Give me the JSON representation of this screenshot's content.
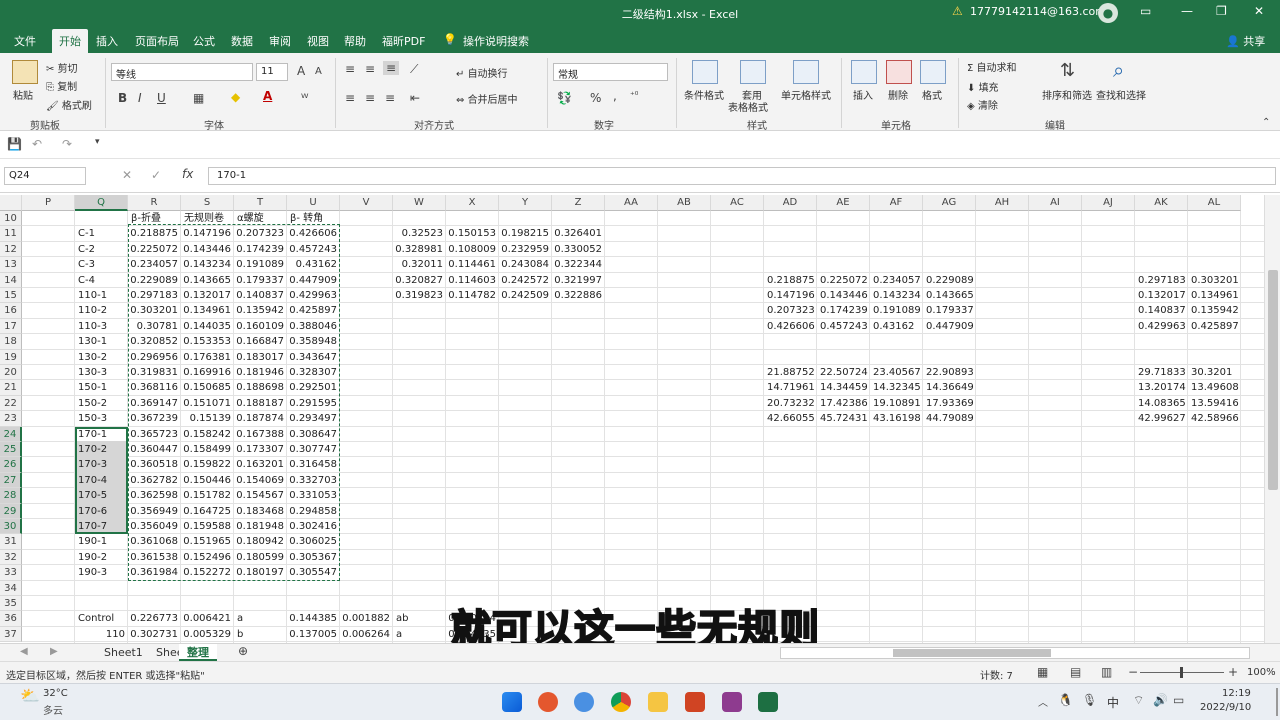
{
  "window": {
    "title": "二级结构1.xlsx  -  Excel",
    "account": "17779142114@163.com"
  },
  "menu": [
    "文件",
    "开始",
    "插入",
    "页面布局",
    "公式",
    "数据",
    "审阅",
    "视图",
    "帮助",
    "福昕PDF",
    "操作说明搜索",
    "共享"
  ],
  "ribbon": {
    "clipboard": {
      "paste": "粘贴",
      "cut": "剪切",
      "copy": "复制",
      "format_painter": "格式刷",
      "group": "剪贴板"
    },
    "font": {
      "name": "等线",
      "size": "11",
      "group": "字体",
      "bold": "B",
      "italic": "I",
      "underline": "U",
      "color_a": "A"
    },
    "align": {
      "wrap": "自动换行",
      "merge": "合并后居中",
      "group": "对齐方式"
    },
    "number": {
      "format": "常规",
      "group": "数字",
      "percent": "%",
      "comma": ","
    },
    "styles": {
      "cond": "条件格式",
      "table1": "套用",
      "table2": "表格格式",
      "cell": "单元格样式",
      "group": "样式"
    },
    "cells": {
      "insert": "插入",
      "delete": "删除",
      "format": "格式",
      "group": "单元格"
    },
    "edit": {
      "autosum": "自动求和",
      "fill": "填充",
      "clear": "清除",
      "sort": "排序和筛选",
      "find": "查找和选择",
      "group": "编辑"
    }
  },
  "formula_bar": {
    "name_box": "Q24",
    "formula": "170-1",
    "fx": "fx"
  },
  "columns": [
    "P",
    "Q",
    "R",
    "S",
    "T",
    "U",
    "V",
    "W",
    "X",
    "Y",
    "Z",
    "AA",
    "AB",
    "AC",
    "AD",
    "AE",
    "AF",
    "AG",
    "AH",
    "AI",
    "AJ",
    "AK",
    "AL"
  ],
  "rows": [
    "10",
    "11",
    "12",
    "13",
    "14",
    "15",
    "16",
    "17",
    "18",
    "19",
    "20",
    "21",
    "22",
    "23",
    "24",
    "25",
    "26",
    "27",
    "28",
    "29",
    "30",
    "31",
    "32",
    "33",
    "34",
    "35",
    "36",
    "37"
  ],
  "headers_row10": {
    "R": "β-折叠",
    "S": "无规则卷",
    "T": "α螺旋",
    "U": "β- 转角"
  },
  "left_table": [
    [
      "C-1",
      "0.218875",
      "0.147196",
      "0.207323",
      "0.426606"
    ],
    [
      "C-2",
      "0.225072",
      "0.143446",
      "0.174239",
      "0.457243"
    ],
    [
      "C-3",
      "0.234057",
      "0.143234",
      "0.191089",
      "0.43162"
    ],
    [
      "C-4",
      "0.229089",
      "0.143665",
      "0.179337",
      "0.447909"
    ],
    [
      "110-1",
      "0.297183",
      "0.132017",
      "0.140837",
      "0.429963"
    ],
    [
      "110-2",
      "0.303201",
      "0.134961",
      "0.135942",
      "0.425897"
    ],
    [
      "110-3",
      "0.30781",
      "0.144035",
      "0.160109",
      "0.388046"
    ],
    [
      "130-1",
      "0.320852",
      "0.153353",
      "0.166847",
      "0.358948"
    ],
    [
      "130-2",
      "0.296956",
      "0.176381",
      "0.183017",
      "0.343647"
    ],
    [
      "130-3",
      "0.319831",
      "0.169916",
      "0.181946",
      "0.328307"
    ],
    [
      "150-1",
      "0.368116",
      "0.150685",
      "0.188698",
      "0.292501"
    ],
    [
      "150-2",
      "0.369147",
      "0.151071",
      "0.188187",
      "0.291595"
    ],
    [
      "150-3",
      "0.367239",
      "0.15139",
      "0.187874",
      "0.293497"
    ],
    [
      "170-1",
      "0.365723",
      "0.158242",
      "0.167388",
      "0.308647"
    ],
    [
      "170-2",
      "0.360447",
      "0.158499",
      "0.173307",
      "0.307747"
    ],
    [
      "170-3",
      "0.360518",
      "0.159822",
      "0.163201",
      "0.316458"
    ],
    [
      "170-4",
      "0.362782",
      "0.150446",
      "0.154069",
      "0.332703"
    ],
    [
      "170-5",
      "0.362598",
      "0.151782",
      "0.154567",
      "0.331053"
    ],
    [
      "170-6",
      "0.356949",
      "0.164725",
      "0.183468",
      "0.294858"
    ],
    [
      "170-7",
      "0.356049",
      "0.159588",
      "0.181948",
      "0.302416"
    ],
    [
      "190-1",
      "0.361068",
      "0.151965",
      "0.180942",
      "0.306025"
    ],
    [
      "190-2",
      "0.361538",
      "0.152496",
      "0.180599",
      "0.305367"
    ],
    [
      "190-3",
      "0.361984",
      "0.152272",
      "0.180197",
      "0.305547"
    ]
  ],
  "wxyz": [
    [
      "0.32523",
      "0.150153",
      "0.198215",
      "0.326401"
    ],
    [
      "0.328981",
      "0.108009",
      "0.232959",
      "0.330052"
    ],
    [
      "0.32011",
      "0.114461",
      "0.243084",
      "0.322344"
    ],
    [
      "0.320827",
      "0.114603",
      "0.242572",
      "0.321997"
    ],
    [
      "0.319823",
      "0.114782",
      "0.242509",
      "0.322886"
    ]
  ],
  "adag": [
    [
      "0.218875",
      "0.225072",
      "0.234057",
      "0.229089"
    ],
    [
      "0.147196",
      "0.143446",
      "0.143234",
      "0.143665"
    ],
    [
      "0.207323",
      "0.174239",
      "0.191089",
      "0.179337"
    ],
    [
      "0.426606",
      "0.457243",
      "0.43162",
      "0.447909"
    ],
    [
      "",
      "",
      "",
      ""
    ],
    [
      "",
      "",
      "",
      ""
    ],
    [
      "21.88752",
      "22.50724",
      "23.40567",
      "22.90893"
    ],
    [
      "14.71961",
      "14.34459",
      "14.32345",
      "14.36649"
    ],
    [
      "20.73232",
      "17.42386",
      "19.10891",
      "17.93369"
    ],
    [
      "42.66055",
      "45.72431",
      "43.16198",
      "44.79089"
    ]
  ],
  "akal": [
    [
      "0.297183",
      "0.303201"
    ],
    [
      "0.132017",
      "0.134961"
    ],
    [
      "0.140837",
      "0.135942"
    ],
    [
      "0.429963",
      "0.425897"
    ],
    [
      "",
      ""
    ],
    [
      "",
      ""
    ],
    [
      "29.71833",
      "30.3201"
    ],
    [
      "13.20174",
      "13.49608"
    ],
    [
      "14.08365",
      "13.59416"
    ],
    [
      "42.99627",
      "42.58966"
    ]
  ],
  "row36": {
    "Q": "Control",
    "R": "0.226773",
    "S": "0.006421",
    "T": "a",
    "U": "0.144385",
    "V": "0.001882",
    "W": "ab",
    "X": "0.440844"
  },
  "row37": {
    "Q": "110",
    "R": "0.302731",
    "S": "0.005329",
    "T": "b",
    "U": "0.137005",
    "V": "0.006264",
    "W": "a",
    "X": "0.414635"
  },
  "sheets": [
    "Sheet1",
    "Sheet2",
    "整理"
  ],
  "status": {
    "hint": "选定目标区域，然后按 ENTER 或选择\"粘贴\"",
    "count": "计数: 7",
    "zoom": "100%"
  },
  "subtitle": "就可以这一些无规则",
  "taskbar": {
    "weather_temp": "32°C",
    "weather_desc": "多云",
    "time": "12:19",
    "date": "2022/9/10",
    "ime": "中"
  }
}
